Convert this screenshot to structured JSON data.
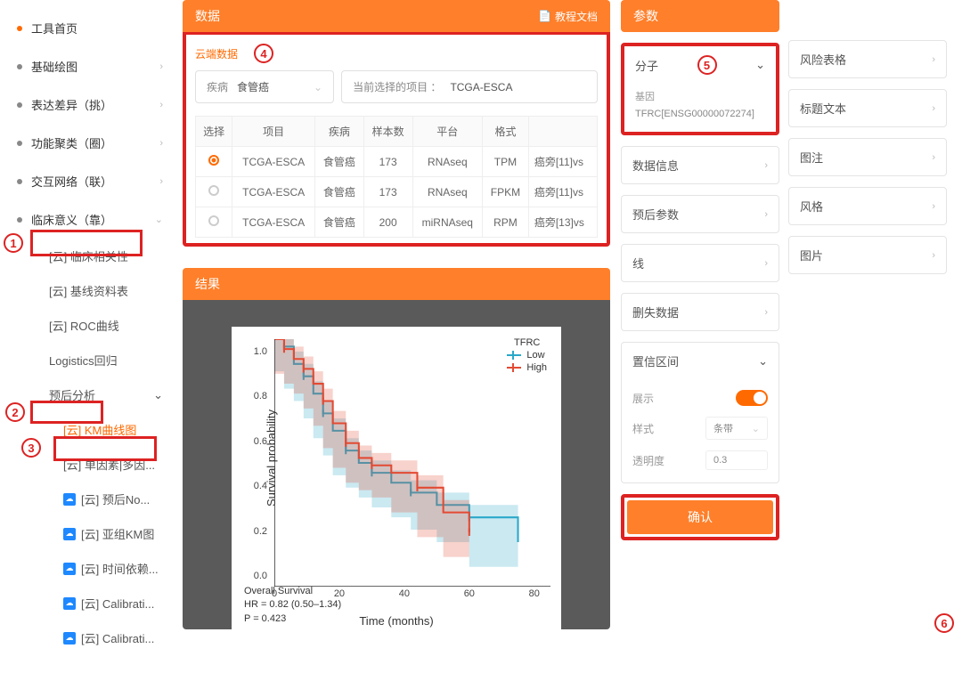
{
  "sidebar": {
    "home": "工具首页",
    "items": [
      {
        "label": "基础绘图"
      },
      {
        "label": "表达差异（挑）"
      },
      {
        "label": "功能聚类（圈）"
      },
      {
        "label": "交互网络（联）"
      },
      {
        "label": "临床意义（靠）"
      }
    ],
    "clinical_children": [
      {
        "label": "[云] 临床相关性"
      },
      {
        "label": "[云] 基线资料表"
      },
      {
        "label": "[云] ROC曲线"
      },
      {
        "label": "Logistics回归"
      }
    ],
    "prognosis": "预后分析",
    "prognosis_children": [
      {
        "label": "[云] KM曲线图",
        "active": true,
        "cloud": false
      },
      {
        "label": "[云] 单因素|多因...",
        "cloud": false
      },
      {
        "label": "[云] 预后No...",
        "cloud": true
      },
      {
        "label": "[云] 亚组KM图",
        "cloud": true
      },
      {
        "label": "[云] 时间依赖...",
        "cloud": true
      },
      {
        "label": "[云] Calibrati...",
        "cloud": true
      },
      {
        "label": "[云] Calibrati...",
        "cloud": true
      }
    ]
  },
  "data_panel": {
    "title": "数据",
    "doc_link": "教程文档",
    "cloud_label": "云端数据",
    "disease_label": "疾病",
    "disease_value": "食管癌",
    "project_label": "当前选择的项目 ：",
    "project_value": "TCGA-ESCA",
    "headers": [
      "选择",
      "项目",
      "疾病",
      "样本数",
      "平台",
      "格式",
      ""
    ],
    "rows": [
      {
        "sel": true,
        "project": "TCGA-ESCA",
        "disease": "食管癌",
        "n": "173",
        "platform": "RNAseq",
        "format": "TPM",
        "extra": "癌旁[11]vs"
      },
      {
        "sel": false,
        "project": "TCGA-ESCA",
        "disease": "食管癌",
        "n": "173",
        "platform": "RNAseq",
        "format": "FPKM",
        "extra": "癌旁[11]vs"
      },
      {
        "sel": false,
        "project": "TCGA-ESCA",
        "disease": "食管癌",
        "n": "200",
        "platform": "miRNAseq",
        "format": "RPM",
        "extra": "癌旁[13]vs"
      }
    ]
  },
  "result_panel": {
    "title": "结果"
  },
  "chart_data": {
    "type": "line",
    "title": "",
    "xlabel": "Time (months)",
    "ylabel": "Survival probability",
    "xlim": [
      0,
      85
    ],
    "ylim": [
      0,
      1
    ],
    "x_ticks": [
      0,
      20,
      40,
      60,
      80
    ],
    "y_ticks": [
      0.0,
      0.2,
      0.4,
      0.6,
      0.8,
      1.0
    ],
    "legend_title": "TFRC",
    "series": [
      {
        "name": "Low",
        "color": "#2aa8c9",
        "x": [
          0,
          3,
          6,
          9,
          12,
          15,
          18,
          22,
          26,
          30,
          36,
          42,
          50,
          60,
          75
        ],
        "y": [
          1.0,
          0.97,
          0.9,
          0.85,
          0.78,
          0.7,
          0.63,
          0.55,
          0.5,
          0.46,
          0.42,
          0.38,
          0.33,
          0.28,
          0.18
        ]
      },
      {
        "name": "High",
        "color": "#e24a33",
        "x": [
          0,
          3,
          6,
          9,
          12,
          15,
          18,
          22,
          26,
          30,
          36,
          44,
          52,
          60
        ],
        "y": [
          1.0,
          0.96,
          0.92,
          0.88,
          0.82,
          0.75,
          0.66,
          0.58,
          0.52,
          0.49,
          0.46,
          0.4,
          0.3,
          0.22
        ]
      }
    ],
    "annotations": [
      "Overall Survival",
      "HR = 0.82 (0.50–1.34)",
      "P = 0.423"
    ]
  },
  "params": {
    "title": "参数",
    "left": [
      {
        "key": "molecule",
        "label": "分子"
      },
      {
        "key": "data_info",
        "label": "数据信息"
      },
      {
        "key": "prognosis_param",
        "label": "预后参数"
      },
      {
        "key": "line",
        "label": "线"
      },
      {
        "key": "missing",
        "label": "删失数据"
      },
      {
        "key": "ci",
        "label": "置信区间"
      }
    ],
    "molecule": {
      "gene_label": "基因",
      "gene_value": "TFRC[ENSG00000072274]"
    },
    "ci": {
      "show_label": "展示",
      "style_label": "样式",
      "style_value": "条带",
      "opacity_label": "透明度",
      "opacity_value": "0.3"
    },
    "right": [
      {
        "label": "风险表格"
      },
      {
        "label": "标题文本"
      },
      {
        "label": "图注"
      },
      {
        "label": "风格"
      },
      {
        "label": "图片"
      }
    ],
    "confirm": "确认"
  },
  "callouts": {
    "1": "1",
    "2": "2",
    "3": "3",
    "4": "4",
    "5": "5",
    "6": "6"
  }
}
